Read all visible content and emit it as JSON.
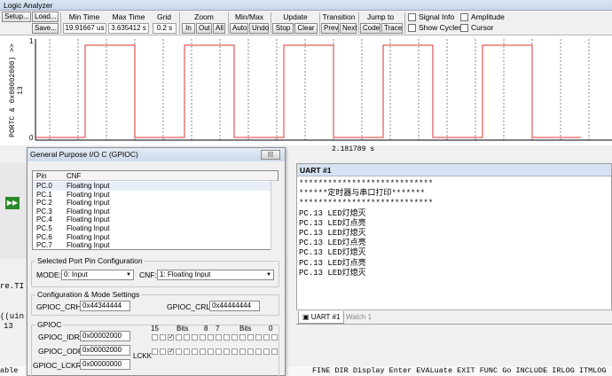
{
  "window": {
    "title": "Logic Analyzer"
  },
  "toolbar": {
    "setup": "Setup...",
    "load": "Load...",
    "save": "Save...",
    "min_time_title": "Min Time",
    "min_time_value": "19.91667 us",
    "max_time_title": "Max Time",
    "max_time_value": "3.635412 s",
    "grid_title": "Grid",
    "grid_value": "0.2 s",
    "zoom_title": "Zoom",
    "zoom_in": "In",
    "zoom_out": "Out",
    "zoom_all": "All",
    "minmax_title": "Min/Max",
    "auto": "Auto",
    "undo": "Undo",
    "update_title": "Update Screen",
    "stop": "Stop",
    "clear": "Clear",
    "transition_title": "Transition",
    "prev": "Prev",
    "next": "Next",
    "jump_title": "Jump to",
    "code": "Code",
    "trace": "Trace",
    "signal_info": "Signal Info",
    "show_cycles": "Show Cycles",
    "amplitude": "Amplitude",
    "cursor": "Cursor"
  },
  "analyzer": {
    "signal_label": "PORTC & 0x00002000) >> 13",
    "y_high": "1",
    "y_low": "0",
    "cursor_time": "2.181789 s",
    "wave_levels": [
      0,
      1,
      0,
      1,
      0,
      1,
      0,
      1,
      0,
      1,
      0,
      1
    ],
    "wave_color": "#e03030"
  },
  "gpio": {
    "title": "General Purpose I/O C (GPIOC)",
    "close": "☒",
    "col_pin": "Pin",
    "col_cnf": "CNF",
    "pins": [
      {
        "pin": "PC.0",
        "cnf": "Floating Input"
      },
      {
        "pin": "PC.1",
        "cnf": "Floating Input"
      },
      {
        "pin": "PC.2",
        "cnf": "Floating Input"
      },
      {
        "pin": "PC.3",
        "cnf": "Floating Input"
      },
      {
        "pin": "PC.4",
        "cnf": "Floating Input"
      },
      {
        "pin": "PC.5",
        "cnf": "Floating Input"
      },
      {
        "pin": "PC.6",
        "cnf": "Floating Input"
      },
      {
        "pin": "PC.7",
        "cnf": "Floating Input"
      }
    ],
    "selected_title": "Selected Port Pin Configuration",
    "mode_label": "MODE:",
    "mode_value": "0: Input",
    "cnf_label": "CNF:",
    "cnf_value": "1: Floating Input",
    "cfg_title": "Configuration & Mode Settings",
    "crh_label": "GPIOC_CRH:",
    "crh_value": "0x44344444",
    "crl_label": "GPIOC_CRL:",
    "crl_value": "0x44444444",
    "gpioc_title": "GPIOC",
    "idr_label": "GPIOC_IDR:",
    "idr_value": "0x00002000",
    "odr_label": "GPIOC_ODR:",
    "odr_value": "0x00002000",
    "lckr_label": "GPIOC_LCKR:",
    "lckr_value": "0x00000000",
    "lckk": "LCKK",
    "bits_hdr": [
      "15",
      "Bits",
      "8",
      "7",
      "Bits",
      "0"
    ]
  },
  "uart": {
    "title": "UART #1",
    "lines": [
      "****************************",
      "******定时器与串口打印*******",
      "****************************",
      "PC.13 LED灯熄灭",
      "PC.13 LED灯点亮",
      "PC.13 LED灯熄灭",
      "PC.13 LED灯点亮",
      "PC.13 LED灯熄灭",
      "PC.13 LED灯点亮",
      "PC.13 LED灯熄灭"
    ],
    "tab_uart": "UART #1",
    "tab_watch": "Watch 1"
  },
  "background": {
    "frag1": "re.TI",
    "frag2": "((uin",
    "frag3": "13",
    "command_line": "able                                                                 FINE DIR Display Enter EVALuate EXIT FUNC Go INCLUDE IRLOG ITMLOG"
  }
}
